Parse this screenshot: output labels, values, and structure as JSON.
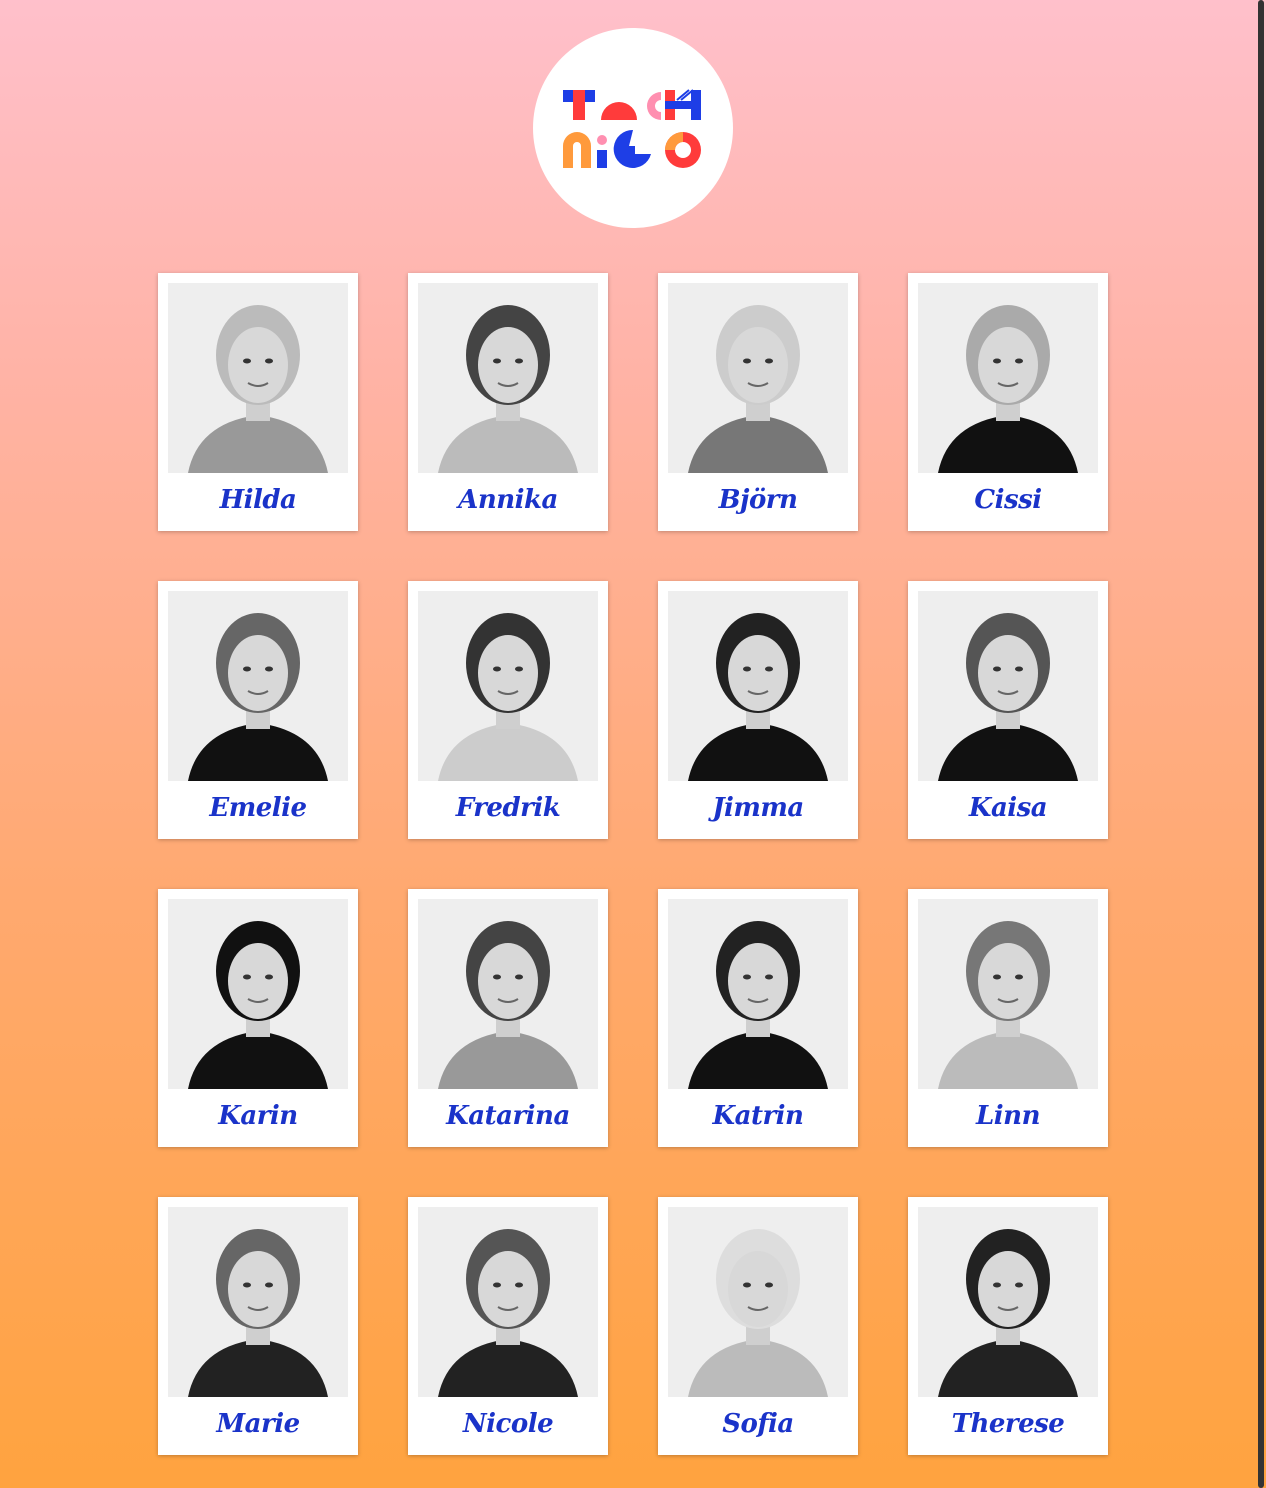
{
  "logo": {
    "text_top": "TECH",
    "text_bottom": "NICO"
  },
  "colors": {
    "name": "#1a33c9",
    "logo_blue": "#1e3ee6",
    "logo_red": "#ff3b3b",
    "logo_pink": "#ff8fb0",
    "logo_orange": "#ff9a3c"
  },
  "people": [
    {
      "name": "Hilda"
    },
    {
      "name": "Annika"
    },
    {
      "name": "Björn"
    },
    {
      "name": "Cissi"
    },
    {
      "name": "Emelie"
    },
    {
      "name": "Fredrik"
    },
    {
      "name": "Jimma"
    },
    {
      "name": "Kaisa"
    },
    {
      "name": "Karin"
    },
    {
      "name": "Katarina"
    },
    {
      "name": "Katrin"
    },
    {
      "name": "Linn"
    },
    {
      "name": "Marie"
    },
    {
      "name": "Nicole"
    },
    {
      "name": "Sofia"
    },
    {
      "name": "Therese"
    }
  ]
}
